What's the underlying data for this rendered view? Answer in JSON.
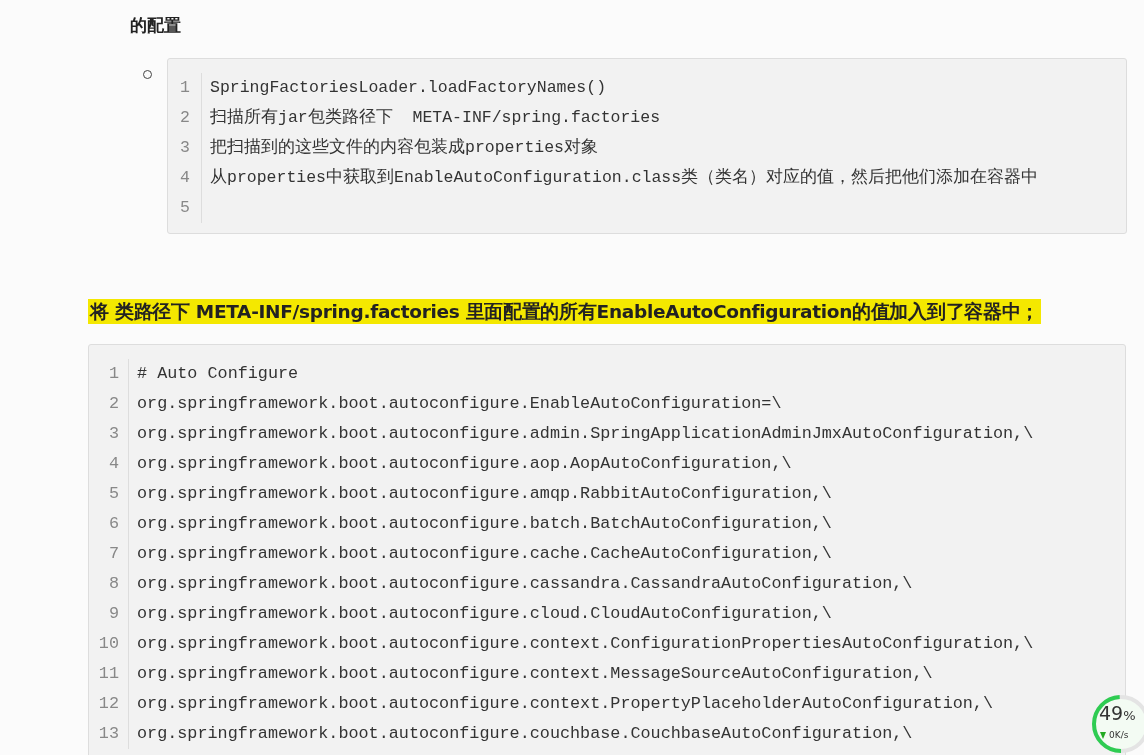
{
  "intro_text": "的配置",
  "list_code_block": {
    "lines": [
      {
        "number": "1",
        "text": "SpringFactoriesLoader.loadFactoryNames()"
      },
      {
        "number": "2",
        "text": "扫描所有jar包类路径下  META-INF/spring.factories"
      },
      {
        "number": "3",
        "text": "把扫描到的这些文件的内容包装成properties对象"
      },
      {
        "number": "4",
        "text": "从properties中获取到EnableAutoConfiguration.class类（类名）对应的值，然后把他们添加在容器中"
      },
      {
        "number": "5"
      }
    ]
  },
  "highlighted_heading": "将 类路径下  META-INF/spring.factories 里面配置的所有EnableAutoConfiguration的值加入到了容器中；",
  "code_block": {
    "lines": [
      {
        "number": "1",
        "text": "# Auto Configure"
      },
      {
        "number": "2",
        "text": "org.springframework.boot.autoconfigure.EnableAutoConfiguration=\\"
      },
      {
        "number": "3",
        "text": "org.springframework.boot.autoconfigure.admin.SpringApplicationAdminJmxAutoConfiguration,\\"
      },
      {
        "number": "4",
        "text": "org.springframework.boot.autoconfigure.aop.AopAutoConfiguration,\\"
      },
      {
        "number": "5",
        "text": "org.springframework.boot.autoconfigure.amqp.RabbitAutoConfiguration,\\"
      },
      {
        "number": "6",
        "text": "org.springframework.boot.autoconfigure.batch.BatchAutoConfiguration,\\"
      },
      {
        "number": "7",
        "text": "org.springframework.boot.autoconfigure.cache.CacheAutoConfiguration,\\"
      },
      {
        "number": "8",
        "text": "org.springframework.boot.autoconfigure.cassandra.CassandraAutoConfiguration,\\"
      },
      {
        "number": "9",
        "text": "org.springframework.boot.autoconfigure.cloud.CloudAutoConfiguration,\\"
      },
      {
        "number": "10",
        "text": "org.springframework.boot.autoconfigure.context.ConfigurationPropertiesAutoConfiguration,\\"
      },
      {
        "number": "11",
        "text": "org.springframework.boot.autoconfigure.context.MessageSourceAutoConfiguration,\\"
      },
      {
        "number": "12",
        "text": "org.springframework.boot.autoconfigure.context.PropertyPlaceholderAutoConfiguration,\\"
      },
      {
        "number": "13",
        "text": "org.springframework.boot.autoconfigure.couchbase.CouchbaseAutoConfiguration,\\"
      }
    ]
  },
  "speed_widget": {
    "value": "49",
    "unit": "%",
    "level": 0.49,
    "speed": "0K/s"
  }
}
